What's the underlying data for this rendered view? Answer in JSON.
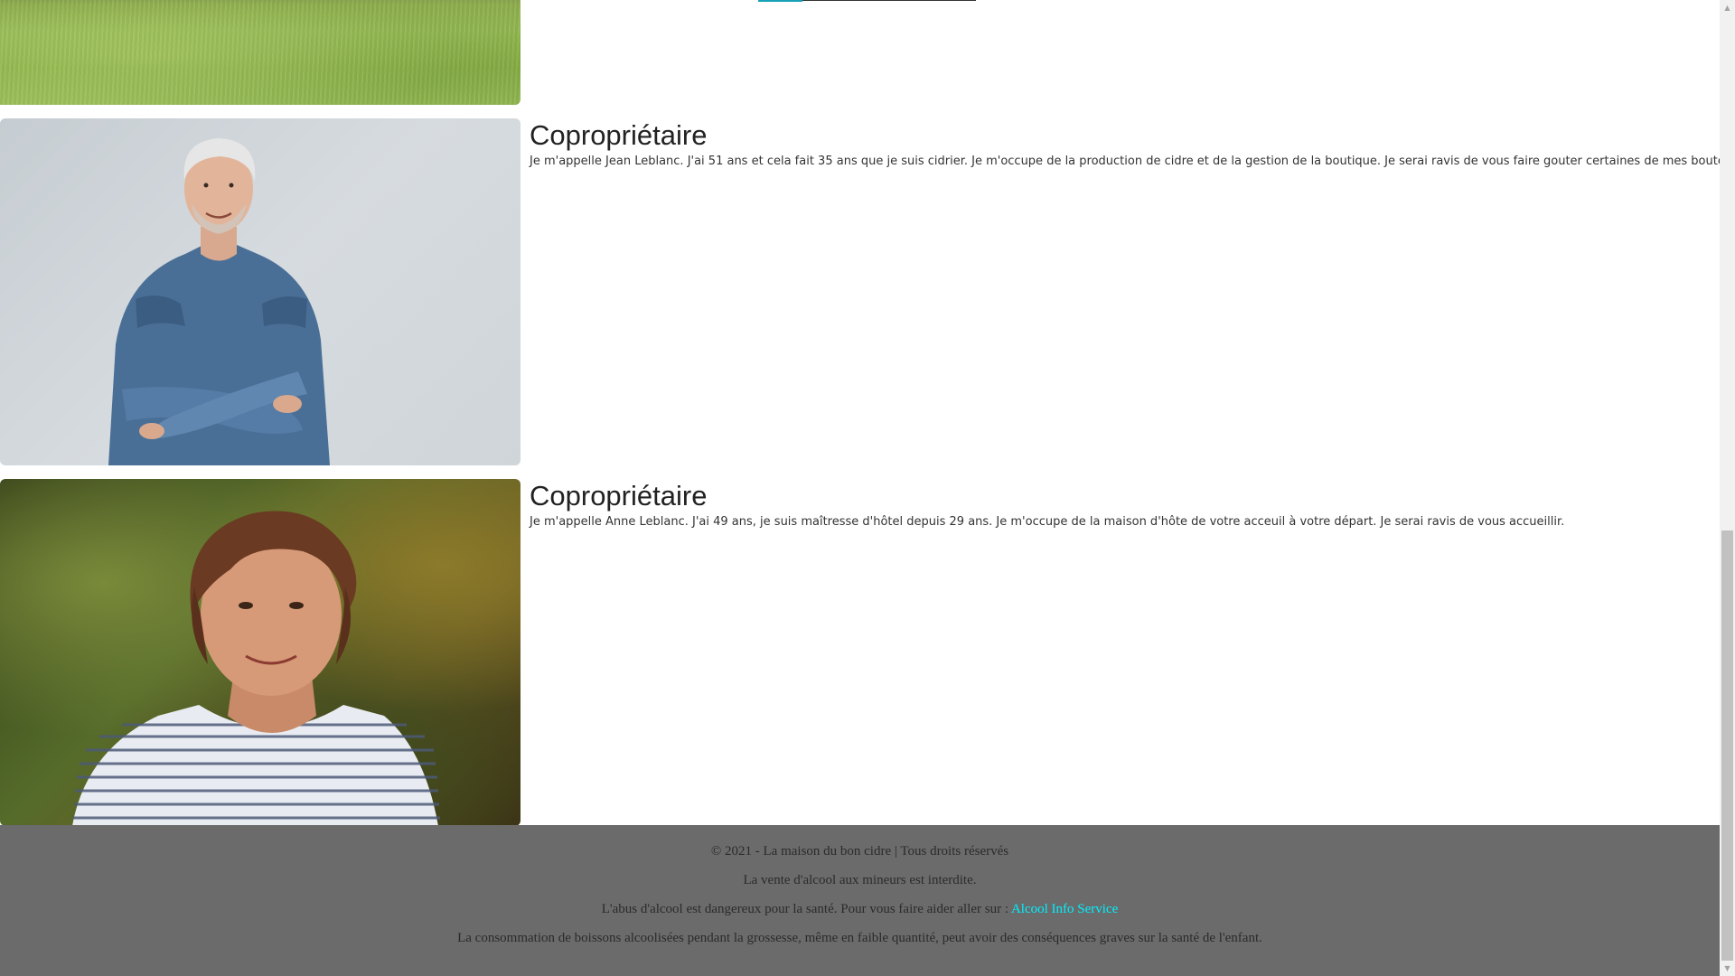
{
  "owners": [
    {
      "title": "Copropriétaire",
      "text": "Je m'appelle Jean Leblanc. J'ai 51 ans et cela fait 35 ans que je suis cidrier. Je m'occupe de la production de cidre et de la gestion de la boutique. Je serai ravis de vous faire gouter certaines de mes bouteilles."
    },
    {
      "title": "Copropriétaire",
      "text": "Je m'appelle Anne Leblanc. J'ai 49 ans, je suis maîtresse d'hôtel depuis 29 ans. Je m'occupe de la maison d'hôte de votre acceuil à votre départ. Je serai ravis de vous accueillir."
    }
  ],
  "footer": {
    "copyright": "© 2021 - La maison du bon cidre | Tous droits réservés",
    "minors": "La vente d'alcool aux mineurs est interdite.",
    "abuse_prefix": "L'abus d'alcool est dangereux pour la santé. Pour vous faire aider aller sur :",
    "abuse_link": "Alcool Info Service",
    "pregnancy": "La consommation de boissons alcoolisées pendant la grossesse, même en faible quantité, peut avoir des conséquences graves sur la santé de l'enfant.",
    "link_color": "#00f0ff",
    "background": "#6b6b6b"
  }
}
